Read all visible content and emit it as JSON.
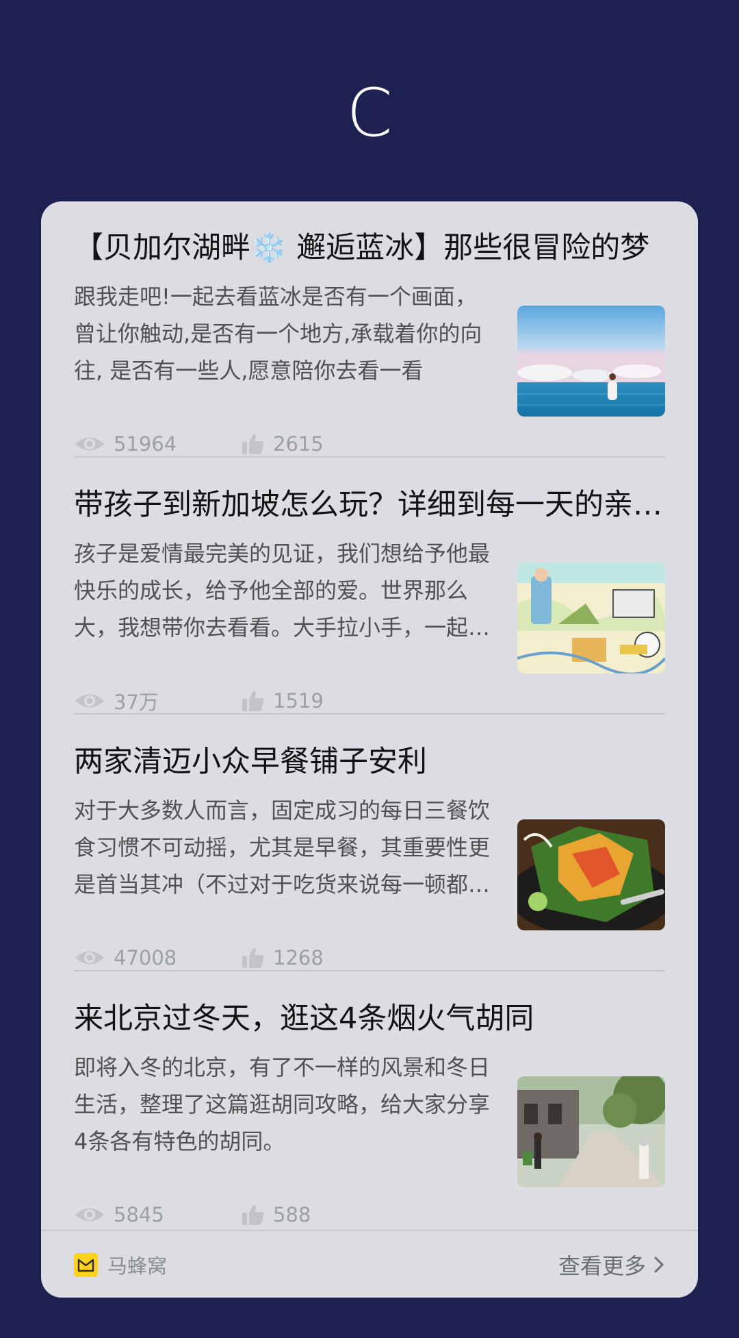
{
  "header": {
    "logo_glyph": "C"
  },
  "articles": [
    {
      "title": "【贝加尔湖畔❄️ 邂逅蓝冰】那些很冒险的梦",
      "summary": "跟我走吧!一起去看蓝冰是否有一个画面，曾让你触动,是否有一个地方,承载着你的向往, 是否有一些人,愿意陪你去看一看",
      "views": "51964",
      "likes": "2615",
      "image": "ocean-girl-photo"
    },
    {
      "title": "带孩子到新加坡怎么玩？详细到每一天的亲子游攻略",
      "summary": "孩子是爱情最完美的见证，我们想给予他最快乐的成长，给予他全部的爱。世界那么大，我想带你去看看。大手拉小手，一起出发",
      "views": "37万",
      "likes": "1519",
      "image": "illustrated-map-photo"
    },
    {
      "title": "两家清迈小众早餐铺子安利",
      "summary": "对于大多数人而言，固定成习的每日三餐饮食习惯不可动摇，尤其是早餐，其重要性更是首当其冲（不过对于吃货来说每一顿都很重要）",
      "views": "47008",
      "likes": "1268",
      "image": "food-dish-photo"
    },
    {
      "title": "来北京过冬天，逛这4条烟火气胡同",
      "summary": "即将入冬的北京，有了不一样的风景和冬日生活，整理了这篇逛胡同攻略，给大家分享4条各有特色的胡同。",
      "views": "5845",
      "likes": "588",
      "image": "hutong-street-photo"
    }
  ],
  "footer": {
    "brand_name": "马蜂窝",
    "more_label": "查看更多"
  },
  "colors": {
    "page_background": "#1d2150",
    "card_background": "#dcdde2",
    "brand_yellow": "#ffd21c"
  }
}
